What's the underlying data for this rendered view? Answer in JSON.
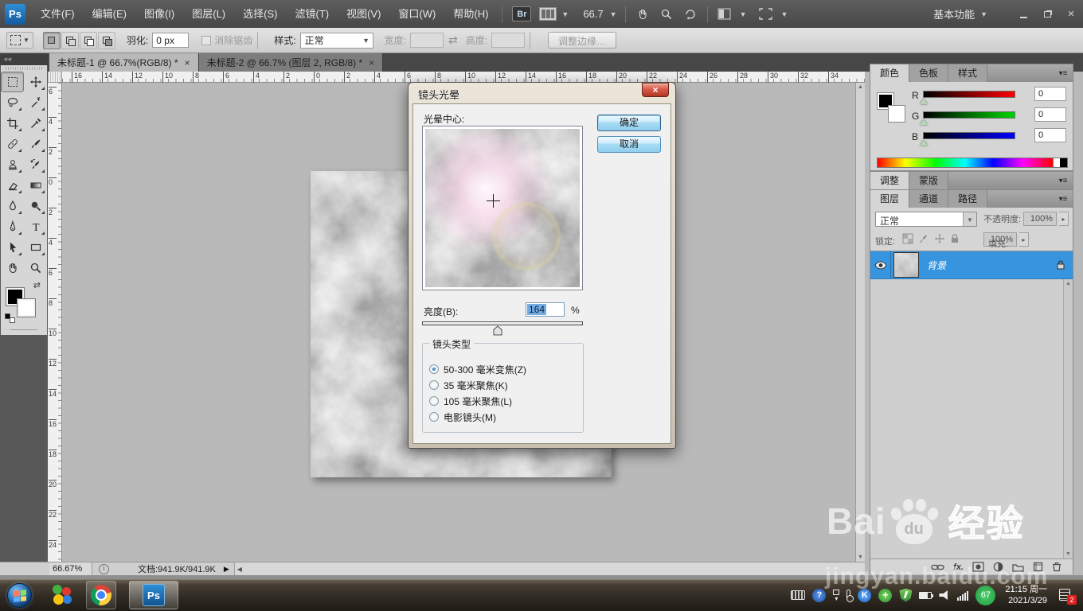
{
  "menu_bar": {
    "logo": "Ps",
    "items": [
      "文件(F)",
      "编辑(E)",
      "图像(I)",
      "图层(L)",
      "选择(S)",
      "滤镜(T)",
      "视图(V)",
      "窗口(W)",
      "帮助(H)"
    ],
    "bridge_label": "Br",
    "zoom_value": "66.7",
    "workspace_label": "基本功能"
  },
  "options_bar": {
    "feather_label": "羽化:",
    "feather_value": "0 px",
    "antialias_label": "消除锯齿",
    "style_label": "样式:",
    "style_value": "正常",
    "width_label": "宽度:",
    "height_label": "高度:",
    "refine_edge_label": "调整边缘…"
  },
  "document_tabs": [
    {
      "label": "未标题-1 @ 66.7%(RGB/8) *",
      "close": "×",
      "active": true
    },
    {
      "label": "未标题-2 @ 66.7% (图层 2, RGB/8) *",
      "close": "×",
      "active": false
    }
  ],
  "rulers": {
    "horizontal": [
      "16",
      "14",
      "12",
      "10",
      "8",
      "6",
      "4",
      "2",
      "0",
      "2",
      "4",
      "6",
      "8",
      "10",
      "12",
      "14",
      "16",
      "18",
      "20",
      "22",
      "24",
      "26",
      "28",
      "30",
      "32",
      "34"
    ],
    "vertical": [
      "6",
      "4",
      "2",
      "0",
      "2",
      "4",
      "6",
      "8",
      "10",
      "12",
      "14",
      "16",
      "18",
      "20",
      "22",
      "24"
    ]
  },
  "dialog": {
    "title": "镜头光晕",
    "close": "×",
    "flare_center_label": "光晕中心:",
    "ok_label": "确定",
    "cancel_label": "取消",
    "brightness_label": "亮度(B):",
    "brightness_value": "164",
    "percent": "%",
    "lens_type_label": "镜头类型",
    "lens_options": [
      {
        "label": "50-300 毫米变焦(Z)",
        "selected": true
      },
      {
        "label": "35 毫米聚焦(K)",
        "selected": false
      },
      {
        "label": "105 毫米聚焦(L)",
        "selected": false
      },
      {
        "label": "电影镜头(M)",
        "selected": false
      }
    ]
  },
  "panels": {
    "color": {
      "tabs": [
        {
          "label": "颜色",
          "active": true
        },
        {
          "label": "色板",
          "active": false
        },
        {
          "label": "样式",
          "active": false
        }
      ],
      "channels": [
        {
          "label": "R",
          "value": "0",
          "color": "#ff0000"
        },
        {
          "label": "G",
          "value": "0",
          "color": "#00d400"
        },
        {
          "label": "B",
          "value": "0",
          "color": "#0000ff"
        }
      ]
    },
    "adjustments": {
      "tabs": [
        {
          "label": "调整",
          "active": true
        },
        {
          "label": "蒙版",
          "active": false
        }
      ]
    },
    "layers": {
      "tabs": [
        {
          "label": "图层",
          "active": true
        },
        {
          "label": "通道",
          "active": false
        },
        {
          "label": "路径",
          "active": false
        }
      ],
      "blend_mode": "正常",
      "opacity_label": "不透明度:",
      "opacity_value": "100%",
      "lock_label": "锁定:",
      "fill_label": "填充:",
      "fill_value": "100%",
      "layer_name": "背景"
    }
  },
  "status_bar": {
    "zoom_value": "66.67%",
    "doc_label": "文档:941.9K/941.9K"
  },
  "taskbar": {
    "battery_percent": "67",
    "time": "21:15 周一",
    "date": "2021/3/29",
    "notification_count": "2",
    "help_glyph": "?",
    "kingsoft_glyph": "K",
    "plus_glyph": "+"
  },
  "watermark": {
    "brand_left": "Bai",
    "paw_text": "du",
    "brand_cn": "经验",
    "url": "jingyan.baidu.com"
  },
  "colors": {
    "selection_blue": "#3795e0",
    "taskbar_green": "#2fb457",
    "dialog_button_blue": "#a8dcf5"
  }
}
